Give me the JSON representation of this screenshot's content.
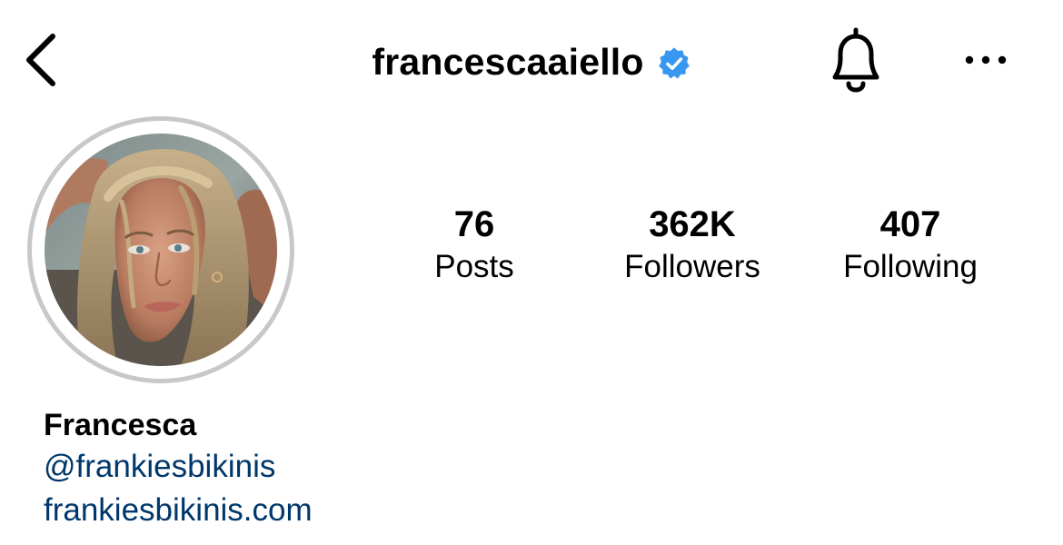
{
  "header": {
    "username": "francescaaiello",
    "verified": true,
    "back_icon": "chevron-left-icon",
    "notification_icon": "bell-icon",
    "more_icon": "more-horizontal-icon",
    "verified_color": "#3897f0"
  },
  "profile": {
    "avatar": "profile-photo",
    "avatar_ring_color": "#c8c8c8",
    "stats": [
      {
        "count": "76",
        "label": "Posts"
      },
      {
        "count": "362K",
        "label": "Followers"
      },
      {
        "count": "407",
        "label": "Following"
      }
    ],
    "bio": {
      "name": "Francesca",
      "mention": "@frankiesbikinis",
      "website": "frankiesbikinis.com",
      "link_color": "#00376b"
    }
  }
}
